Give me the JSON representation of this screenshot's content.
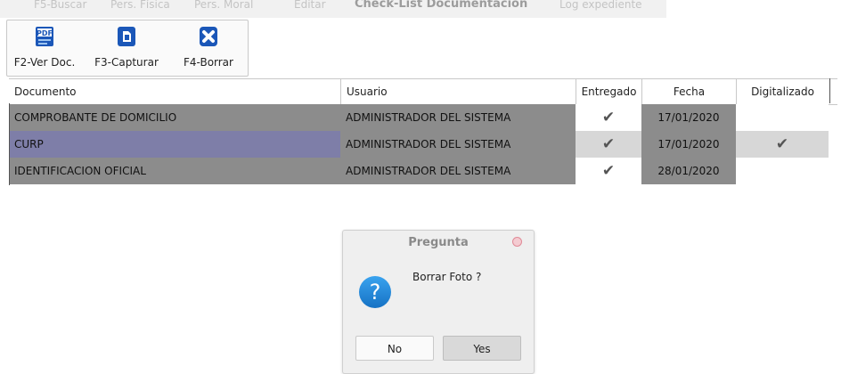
{
  "tabs": [
    {
      "label": "F5-Buscar"
    },
    {
      "label": "Pers. Física"
    },
    {
      "label": "Pers. Moral"
    },
    {
      "label": "Editar"
    },
    {
      "label": "Check-List Documentación",
      "active": true
    },
    {
      "label": "Log expediente"
    }
  ],
  "toolbar": {
    "buttons": [
      {
        "label": "F2-Ver Doc.",
        "icon": "pdf-icon"
      },
      {
        "label": "F3-Capturar",
        "icon": "capture-icon"
      },
      {
        "label": "F4-Borrar",
        "icon": "delete-icon"
      }
    ]
  },
  "grid": {
    "columns": [
      "Documento",
      "Usuario",
      "Entregado",
      "Fecha",
      "Digitalizado"
    ],
    "rows": [
      {
        "documento": "COMPROBANTE DE DOMICILIO",
        "usuario": "ADMINISTRADOR DEL SISTEMA",
        "entregado": "✔",
        "fecha": "17/01/2020",
        "digitalizado": ""
      },
      {
        "documento": "CURP",
        "usuario": "ADMINISTRADOR DEL SISTEMA",
        "entregado": "✔",
        "fecha": "17/01/2020",
        "digitalizado": "✔"
      },
      {
        "documento": "IDENTIFICACION OFICIAL",
        "usuario": "ADMINISTRADOR DEL SISTEMA",
        "entregado": "✔",
        "fecha": "28/01/2020",
        "digitalizado": ""
      }
    ]
  },
  "dialog": {
    "title": "Pregunta",
    "message": "Borrar Foto ?",
    "no_label": "No",
    "yes_label": "Yes"
  },
  "colors": {
    "shade": "#8c8c8c",
    "selected": "#7e7ea8",
    "row_light": "#d7d7d7",
    "accent_blue": "#1a84d4"
  }
}
